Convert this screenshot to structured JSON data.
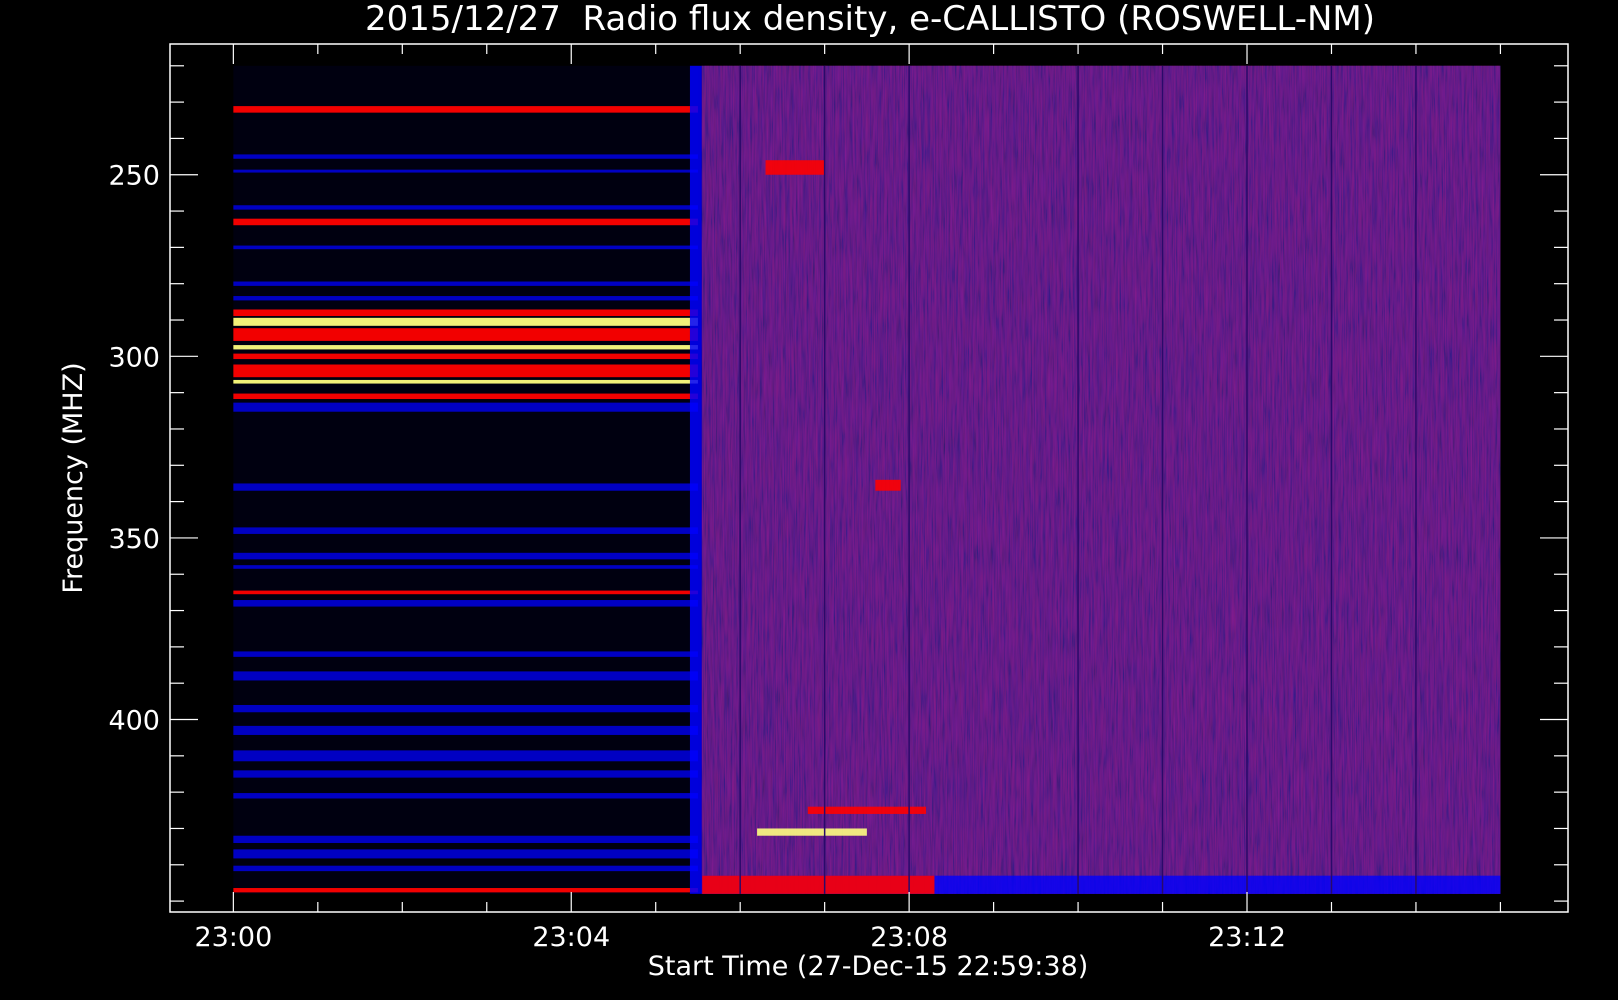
{
  "chart_data": {
    "type": "heatmap",
    "title": "2015/12/27  Radio flux density, e-CALLISTO (ROSWELL-NM)",
    "xlabel": "Start Time (27-Dec-15 22:59:38)",
    "ylabel": "Frequency (MHZ)",
    "x_tick_labels": [
      "23:00",
      "23:04",
      "23:08",
      "23:12"
    ],
    "x_tick_minutes": [
      0,
      4,
      8,
      12
    ],
    "y_tick_labels": [
      "250",
      "300",
      "350",
      "400"
    ],
    "y_tick_values": [
      250,
      300,
      350,
      400
    ],
    "y_axis_inverted": true,
    "xlim_minutes": [
      -0.75,
      15.8
    ],
    "ylim_mhz": [
      214,
      453
    ],
    "data_time_range_minutes": [
      0,
      15
    ],
    "data_freq_range_mhz": [
      220,
      448
    ],
    "regime_change_minute": 5.5,
    "colors": {
      "background": "#000000",
      "low": "#0000ff",
      "mid": "#ff0000",
      "high": "#ffff80",
      "diffuse": "#5a2a96"
    },
    "early_bands_mhz": [
      {
        "freq": 232,
        "width": 1.8,
        "level": "mid"
      },
      {
        "freq": 245,
        "width": 1.2,
        "level": "low"
      },
      {
        "freq": 249,
        "width": 0.8,
        "level": "low"
      },
      {
        "freq": 259,
        "width": 1.2,
        "level": "low"
      },
      {
        "freq": 263,
        "width": 1.8,
        "level": "mid"
      },
      {
        "freq": 270,
        "width": 1.0,
        "level": "low"
      },
      {
        "freq": 280,
        "width": 1.2,
        "level": "low"
      },
      {
        "freq": 284,
        "width": 1.2,
        "level": "low"
      },
      {
        "freq": 288,
        "width": 1.8,
        "level": "mid"
      },
      {
        "freq": 290.5,
        "width": 2.2,
        "level": "high"
      },
      {
        "freq": 294,
        "width": 3.5,
        "level": "mid"
      },
      {
        "freq": 297.5,
        "width": 1.2,
        "level": "high"
      },
      {
        "freq": 300,
        "width": 1.5,
        "level": "mid"
      },
      {
        "freq": 304,
        "width": 3.5,
        "level": "mid"
      },
      {
        "freq": 307,
        "width": 1.0,
        "level": "high"
      },
      {
        "freq": 311,
        "width": 1.5,
        "level": "mid"
      },
      {
        "freq": 314,
        "width": 2.5,
        "level": "low"
      },
      {
        "freq": 336,
        "width": 2.0,
        "level": "low"
      },
      {
        "freq": 348,
        "width": 1.8,
        "level": "low"
      },
      {
        "freq": 355,
        "width": 1.8,
        "level": "low"
      },
      {
        "freq": 358,
        "width": 1.0,
        "level": "low"
      },
      {
        "freq": 365,
        "width": 1.0,
        "level": "mid"
      },
      {
        "freq": 368,
        "width": 1.8,
        "level": "low"
      },
      {
        "freq": 382,
        "width": 1.5,
        "level": "low"
      },
      {
        "freq": 388,
        "width": 2.5,
        "level": "low"
      },
      {
        "freq": 397,
        "width": 2.0,
        "level": "low"
      },
      {
        "freq": 403,
        "width": 2.5,
        "level": "low"
      },
      {
        "freq": 410,
        "width": 3.0,
        "level": "low"
      },
      {
        "freq": 415,
        "width": 2.0,
        "level": "low"
      },
      {
        "freq": 421,
        "width": 1.5,
        "level": "low"
      },
      {
        "freq": 433,
        "width": 2.0,
        "level": "low"
      },
      {
        "freq": 437,
        "width": 2.5,
        "level": "low"
      },
      {
        "freq": 441,
        "width": 1.5,
        "level": "low"
      },
      {
        "freq": 447,
        "width": 1.2,
        "level": "mid"
      }
    ],
    "late_features": [
      {
        "t0": 5.55,
        "t1": 8.3,
        "f0": 443,
        "f1": 448,
        "level": "mid"
      },
      {
        "t0": 6.2,
        "t1": 7.5,
        "f0": 430,
        "f1": 432,
        "level": "high"
      },
      {
        "t0": 7.6,
        "t1": 7.9,
        "f0": 334,
        "f1": 337,
        "level": "mid"
      },
      {
        "t0": 6.3,
        "t1": 7.0,
        "f0": 246,
        "f1": 250,
        "level": "mid"
      },
      {
        "t0": 6.8,
        "t1": 8.2,
        "f0": 424,
        "f1": 426,
        "level": "mid"
      }
    ],
    "vertical_rules_minutes": [
      6.0,
      7.0,
      8.0,
      10.0,
      11.0,
      12.0,
      13.0,
      14.0
    ]
  }
}
